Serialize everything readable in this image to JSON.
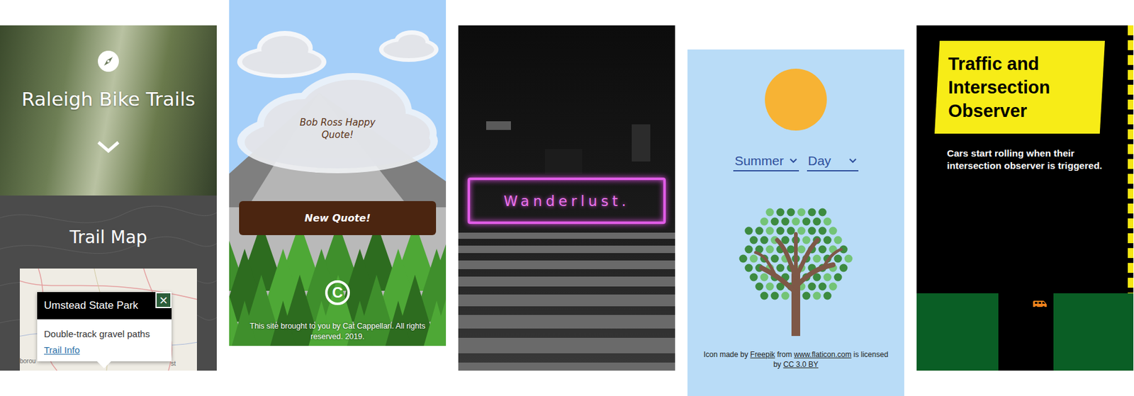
{
  "trails": {
    "title": "Raleigh Bike Trails",
    "section": "Trail Map",
    "map_labels": [
      "borou",
      "st"
    ],
    "popup": {
      "title": "Umstead State Park",
      "close": "×",
      "description": "Double-track gravel paths",
      "link": "Trail Info"
    }
  },
  "bob_ross": {
    "quote": "Bob Ross Happy Quote!",
    "button": "New Quote!",
    "logo": "C",
    "footer": "This site brought to you by Cat Cappellari. All rights reserved. 2019."
  },
  "wanderlust": {
    "title": "Wanderlust."
  },
  "seasons": {
    "selects": [
      {
        "value": "Summer"
      },
      {
        "value": "Day"
      }
    ],
    "credit": [
      {
        "text": "Icon made by ",
        "link": false
      },
      {
        "text": "Freepik",
        "link": true
      },
      {
        "text": " from ",
        "link": false
      },
      {
        "text": "www.flaticon.com",
        "link": true
      },
      {
        "text": " is licensed by ",
        "link": false
      },
      {
        "text": "CC 3.0 BY",
        "link": true
      }
    ]
  },
  "traffic": {
    "title": "Traffic and Intersection Observer",
    "subtitle": "Cars start rolling when their intersection observer is triggered."
  }
}
